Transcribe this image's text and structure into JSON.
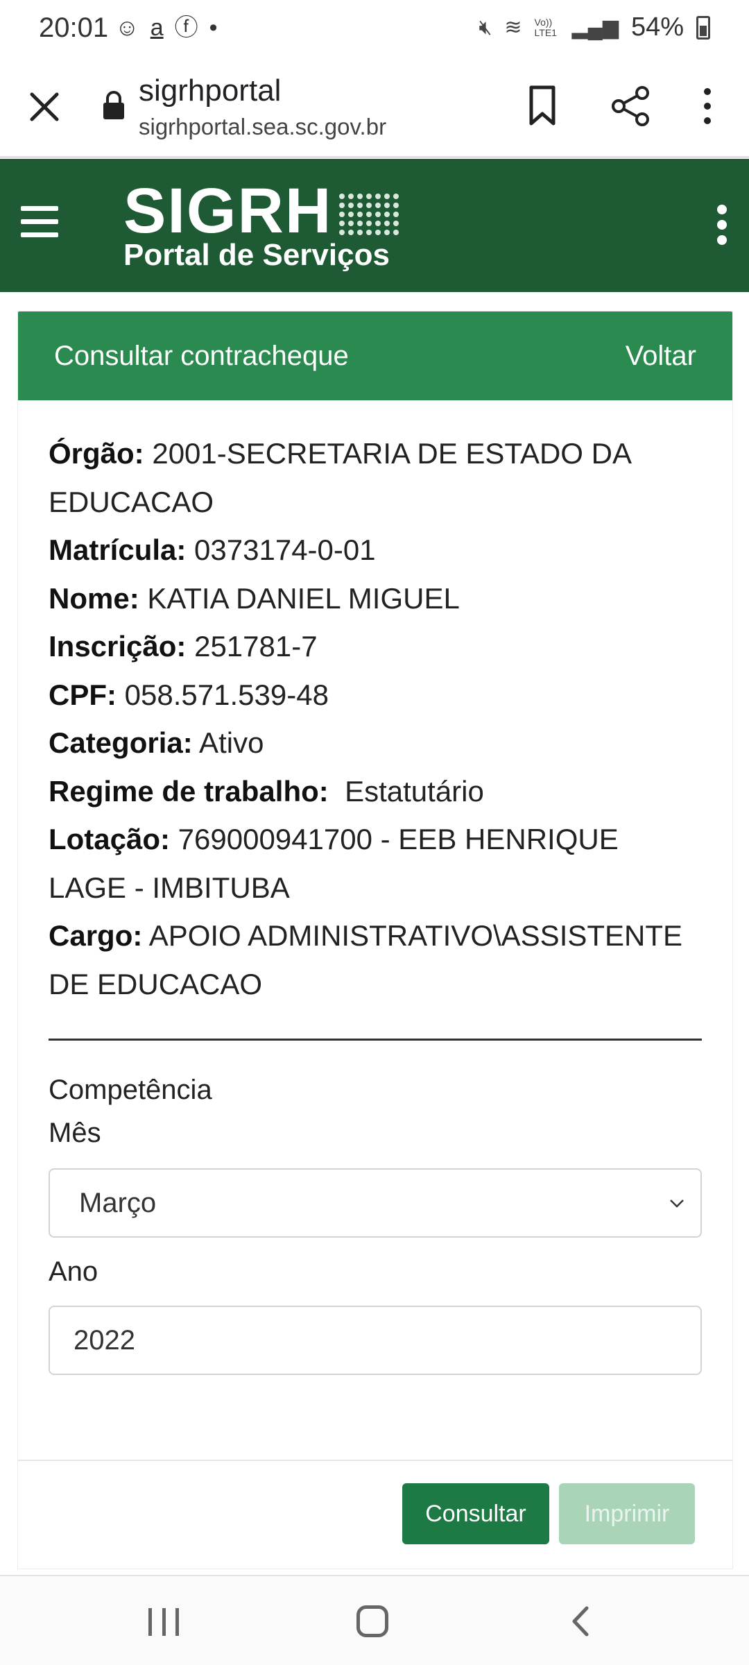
{
  "status_bar": {
    "time": "20:01",
    "battery": "54%",
    "left_icons": [
      "emoji-notification-icon",
      "amazon-icon",
      "facebook-icon",
      "dot-icon"
    ],
    "right_icons": [
      "mute-icon",
      "wifi-icon",
      "volte-icon",
      "signal-icon",
      "battery-icon"
    ],
    "volte_label": "Vo)) LTE1"
  },
  "browser": {
    "title": "sigrhportal",
    "url": "sigrhportal.sea.sc.gov.br"
  },
  "app_header": {
    "logo_main": "SIGRH",
    "logo_sub": "Portal de Serviços",
    "color": "#1e5a33"
  },
  "card": {
    "title": "Consultar contracheque",
    "back_label": "Voltar",
    "header_color": "#2a8a4f",
    "fields": [
      {
        "label": "Órgão:",
        "value": " 2001-SECRETARIA DE ESTADO DA EDUCACAO"
      },
      {
        "label": "Matrícula:",
        "value": " 0373174-0-01"
      },
      {
        "label": "Nome:",
        "value": " KATIA DANIEL MIGUEL"
      },
      {
        "label": "Inscrição:",
        "value": " 251781-7"
      },
      {
        "label": "CPF:",
        "value": " 058.571.539-48"
      },
      {
        "label": "Categoria:",
        "value": " Ativo"
      },
      {
        "label": "Regime de trabalho:",
        "value": "  Estatutário"
      },
      {
        "label": "Lotação:",
        "value": " 769000941700 - EEB HENRIQUE LAGE - IMBITUBA"
      },
      {
        "label": "Cargo:",
        "value": " APOIO ADMINISTRATIVO\\ASSISTENTE DE EDUCACAO"
      }
    ],
    "form": {
      "competencia_label": "Competência",
      "mes_label": "Mês",
      "mes_value": "Março",
      "ano_label": "Ano",
      "ano_value": "2022"
    },
    "buttons": {
      "consultar": "Consultar",
      "imprimir": "Imprimir"
    }
  }
}
